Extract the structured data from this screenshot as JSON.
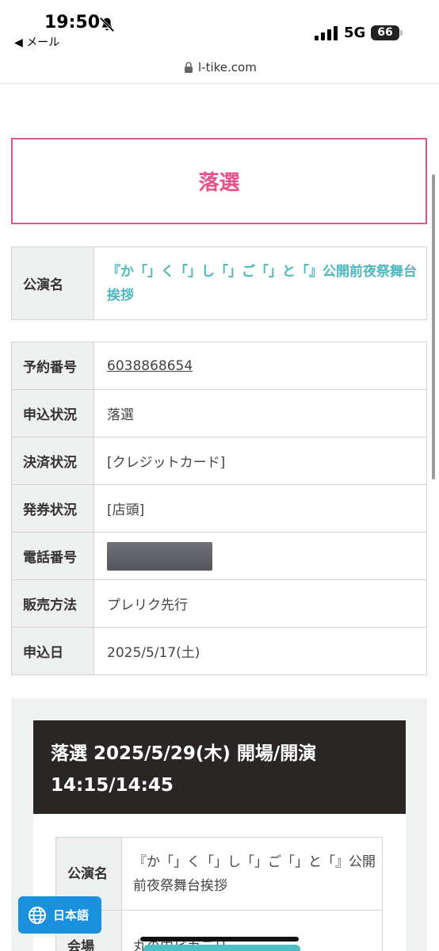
{
  "status": {
    "time": "19:50",
    "back_label": "◀ メール",
    "network": "5G",
    "battery": "66"
  },
  "browser": {
    "url": "l-tike.com"
  },
  "result": {
    "title": "落選"
  },
  "performance": {
    "label": "公演名",
    "name": "『か「」く「」し「」ご「」と「』公開前夜祭舞台挨拶"
  },
  "info": {
    "rows": [
      {
        "label": "予約番号",
        "value": "6038868654"
      },
      {
        "label": "申込状況",
        "value": "落選"
      },
      {
        "label": "決済状況",
        "value": "[クレジットカード]"
      },
      {
        "label": "発券状況",
        "value": "[店頭]"
      },
      {
        "label": "電話番号",
        "value": ""
      },
      {
        "label": "販売方法",
        "value": "プレリク先行"
      },
      {
        "label": "申込日",
        "value": "2025/5/17(土)"
      }
    ]
  },
  "detail": {
    "header": "落選 2025/5/29(木) 開場/開演 14:15/14:45",
    "rows": [
      {
        "label": "公演名",
        "value": "『か「」く「」し「」ご「」と「』公開前夜祭舞台挨拶"
      },
      {
        "label": "会場",
        "value": "丸の内ピカデリー"
      }
    ]
  },
  "language_button": {
    "label": "日本語"
  },
  "colors": {
    "accent_pink": "#e8528c",
    "accent_teal": "#4bb8bf",
    "lang_blue": "#1a90df"
  }
}
